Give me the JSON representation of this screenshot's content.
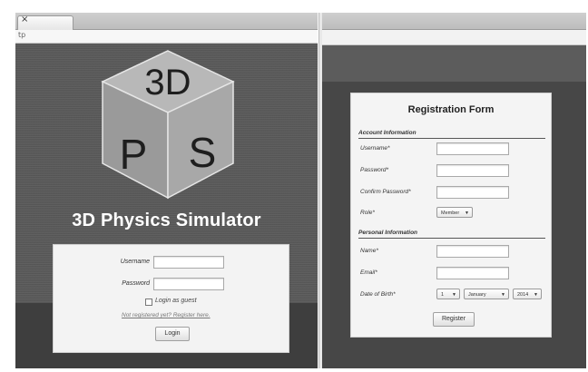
{
  "left_window": {
    "tab_close": "×",
    "url_text": "tp",
    "logo": {
      "top_text": "3D",
      "left_text": "P",
      "right_text": "S"
    },
    "app_title": "3D Physics Simulator",
    "login": {
      "username_label": "Username",
      "password_label": "Password",
      "guest_label": "Login as guest",
      "register_link": "Not registered yet? Register here.",
      "login_button": "Login"
    }
  },
  "right_window": {
    "title": "Registration Form",
    "account_section": "Account Information",
    "username_label": "Username*",
    "password_label": "Password*",
    "confirm_label": "Confirm Password*",
    "role_label": "Role*",
    "role_value": "Member",
    "personal_section": "Personal Information",
    "name_label": "Name*",
    "email_label": "Email*",
    "dob_label": "Date of Birth*",
    "dob_day": "1",
    "dob_month": "January",
    "dob_year": "2014",
    "register_button": "Register"
  },
  "colors": {
    "app_background": "#5a5a5a",
    "panel_background": "#f3f3f3",
    "title_text": "#ffffff"
  }
}
